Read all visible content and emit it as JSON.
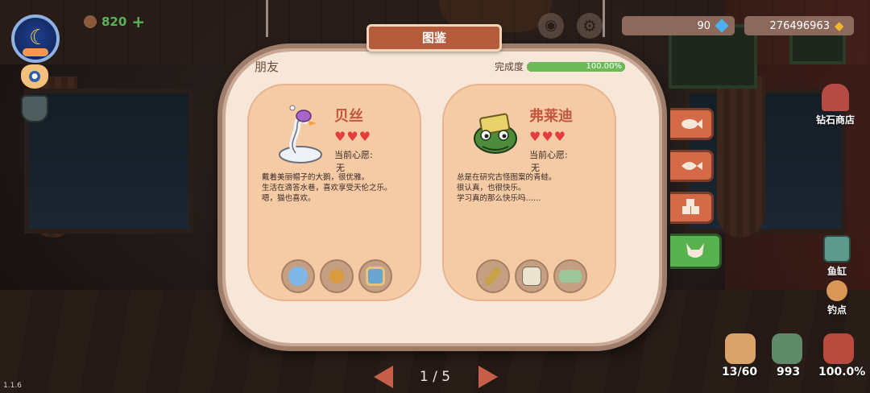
{
  "hud": {
    "cookie_count": "820",
    "plus_symbol": "+",
    "diamonds": "90",
    "fish": "276496963",
    "version": "1.1.6"
  },
  "sidebar_right": {
    "diamond_shop": "钻石商店",
    "fishtank": "鱼缸",
    "fishing_spot": "钓点"
  },
  "bottom_bar": {
    "bait_count": "13/60",
    "backpack_count": "993",
    "book_percent": "100.0%"
  },
  "panel": {
    "title": "图鉴",
    "section": "朋友",
    "completion_label": "完成度",
    "completion_text": "100.00%",
    "completion_fraction": 1.0
  },
  "cards": [
    {
      "name": "贝丝",
      "hearts": "♥♥♥",
      "wish_label": "当前心愿:",
      "wish_value": "无",
      "desc": [
        "戴着美丽帽子的大鹅，很优雅。",
        "生活在滴答水巷，喜欢享受天伦之乐。",
        "嗯，猫也喜欢。"
      ],
      "item_icons": [
        "mirror-icon",
        "snail-icon",
        "photo-icon"
      ]
    },
    {
      "name": "弗莱迪",
      "hearts": "♥♥♥",
      "wish_label": "当前心愿:",
      "wish_value": "无",
      "desc": [
        "总是在研究古怪图案的青蛙。",
        "很认真，也很快乐。",
        "学习真的那么快乐吗……"
      ],
      "item_icons": [
        "spyglass-icon",
        "newspaper-icon",
        "banknote-icon"
      ]
    }
  ],
  "category_tabs": [
    "fish-icon",
    "flatfish-icon",
    "cube-icon",
    "fox-icon"
  ],
  "pager": {
    "label": "1 / 5"
  },
  "colors": {
    "panel_bg": "#f7e7d8",
    "card_bg": "#f5cba6",
    "title_tab": "#b35b3b",
    "name_text": "#c3573f",
    "progress_green": "#6cba57",
    "active_tab": "#57b24f",
    "inactive_tab": "#d46a48"
  }
}
